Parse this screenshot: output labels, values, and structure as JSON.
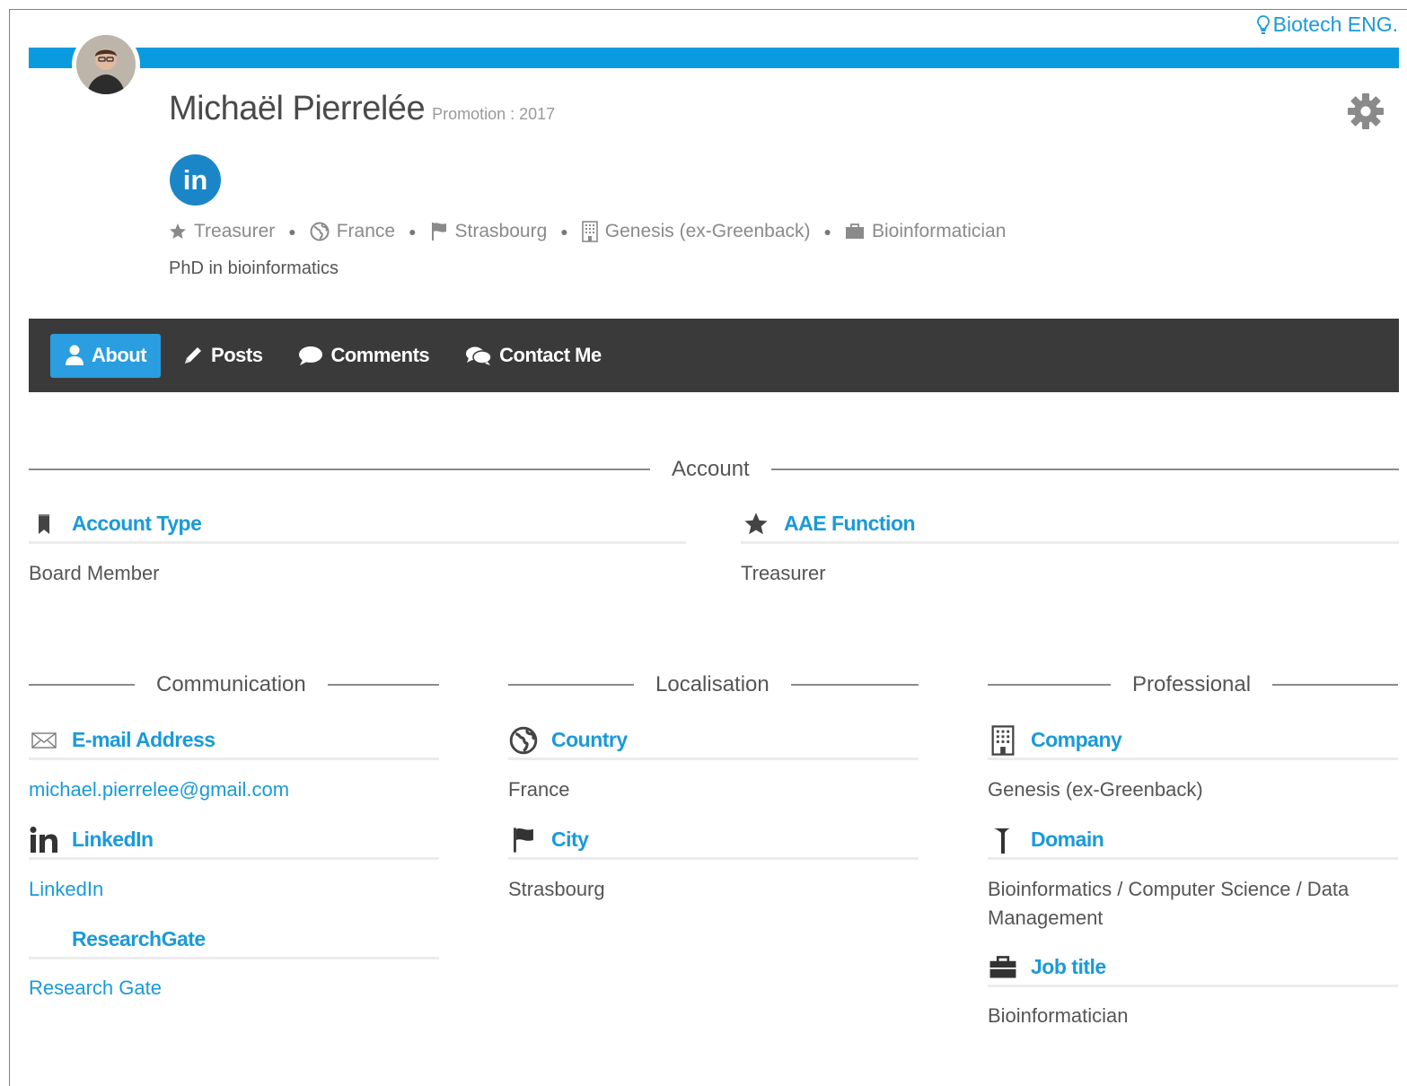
{
  "group_link": "Biotech ENG.",
  "profile": {
    "name": "Michaël Pierrelée",
    "promotion": "Promotion : 2017",
    "degree": "PhD in bioinformatics",
    "meta": {
      "function": "Treasurer",
      "country": "France",
      "city": "Strasbourg",
      "company": "Genesis (ex-Greenback)",
      "job": "Bioinformatician"
    }
  },
  "tabs": [
    {
      "label": "About"
    },
    {
      "label": "Posts"
    },
    {
      "label": "Comments"
    },
    {
      "label": "Contact Me"
    }
  ],
  "sections": {
    "account": {
      "title": "Account",
      "account_type": {
        "label": "Account Type",
        "value": "Board Member"
      },
      "aae_function": {
        "label": "AAE Function",
        "value": "Treasurer"
      }
    },
    "communication": {
      "title": "Communication",
      "email": {
        "label": "E-mail Address",
        "value": "michael.pierrelee@gmail.com"
      },
      "linkedin": {
        "label": "LinkedIn",
        "value": "LinkedIn"
      },
      "researchgate": {
        "label": "ResearchGate",
        "value": "Research Gate"
      }
    },
    "localisation": {
      "title": "Localisation",
      "country": {
        "label": "Country",
        "value": "France"
      },
      "city": {
        "label": "City",
        "value": "Strasbourg"
      }
    },
    "professional": {
      "title": "Professional",
      "company": {
        "label": "Company",
        "value": "Genesis (ex-Greenback)"
      },
      "domain": {
        "label": "Domain",
        "value": "Bioinformatics / Computer Science / Data Management"
      },
      "job_title": {
        "label": "Job title",
        "value": "Bioinformatician"
      }
    }
  },
  "colors": {
    "accent": "#0a9ae0",
    "link": "#1a9ad9",
    "tabbar": "#3a3a3a",
    "active_tab": "#2a9ee0"
  }
}
